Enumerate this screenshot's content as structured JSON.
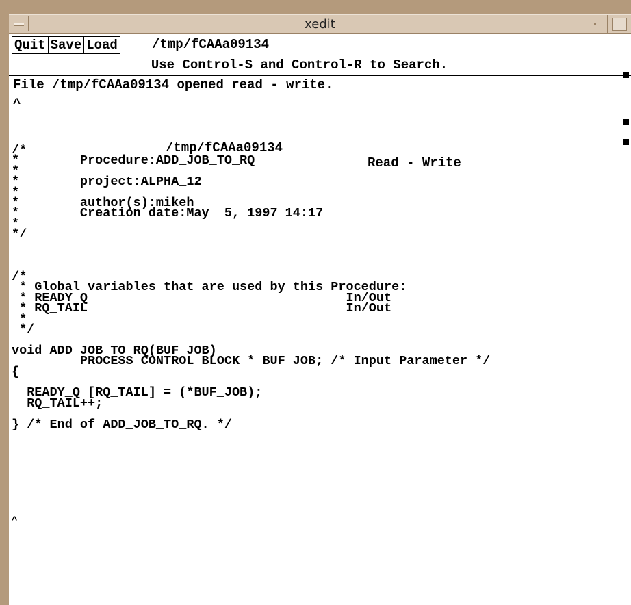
{
  "window": {
    "title": "xedit"
  },
  "toolbar": {
    "quit_label": "Quit",
    "save_label": "Save",
    "load_label": "Load",
    "filename": "/tmp/fCAAa09134"
  },
  "hint": "Use Control-S and Control-R to Search.",
  "message": {
    "text": "File /tmp/fCAAa09134 opened read - write.",
    "cursor": "^"
  },
  "status": {
    "file": "/tmp/fCAAa09134",
    "mode": "Read - Write"
  },
  "editor": {
    "content": "/*\n*        Procedure:ADD_JOB_TO_RQ\n*\n*        project:ALPHA_12\n*\n*        author(s):mikeh\n*        Creation date:May  5, 1997 14:17\n*\n*/\n\n\n\n/*\n * Global variables that are used by this Procedure:\n * READY_Q                                  In/Out\n * RQ_TAIL                                  In/Out\n *\n */\n\nvoid ADD_JOB_TO_RQ(BUF_JOB)\n         PROCESS_CONTROL_BLOCK * BUF_JOB; /* Input Parameter */\n{\n\n  READY_Q [RQ_TAIL] = (*BUF_JOB);\n  RQ_TAIL++;\n\n} /* End of ADD_JOB_TO_RQ. */",
    "cursor": "^"
  }
}
